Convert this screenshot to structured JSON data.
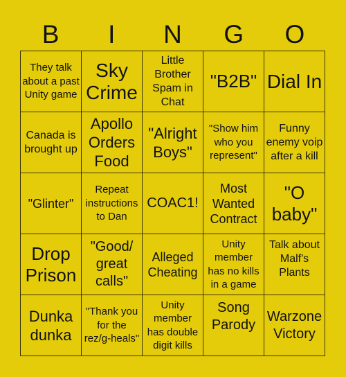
{
  "header": {
    "letters": [
      "B",
      "I",
      "N",
      "G",
      "O"
    ]
  },
  "colors": {
    "background": "#E4CC0A",
    "grid_line": "#3a3300",
    "text": "#111111"
  },
  "cells": [
    [
      "They talk about a past Unity game",
      "Sky Crime",
      "Little Brother Spam in Chat",
      "\"B2B\"",
      "Dial In"
    ],
    [
      "Canada is brought up",
      "Apollo Orders Food",
      "\"Alright Boys\"",
      "\"Show him who you represent\"",
      "Funny enemy voip after a kill"
    ],
    [
      "\"Glinter\"",
      "Repeat instructions to Dan",
      "COAC1!",
      "Most Wanted Contract",
      "\"O baby\""
    ],
    [
      "Drop Prison",
      "\"Good/ great calls\"",
      "Alleged Cheating",
      "Unity member has no kills in a game",
      "Talk about Malf's Plants"
    ],
    [
      "Dunka dunka",
      "\"Thank you for the rez/g-heals\"",
      "Unity member has double digit kills",
      "Song Parody",
      "Warzone Victory"
    ]
  ]
}
